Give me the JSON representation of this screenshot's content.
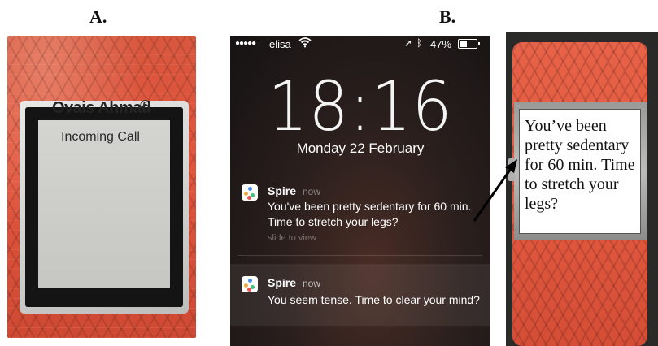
{
  "labels": {
    "panel_a": "A.",
    "panel_b": "B."
  },
  "watch_a": {
    "caller_name": "Ovais Ahmad",
    "phone_icon": "phone-icon",
    "call_status": "Incoming Call"
  },
  "lockscreen": {
    "status_bar": {
      "signal": "●●●●●",
      "carrier": "elisa",
      "wifi_icon": "wifi-icon",
      "location_icon": "location-arrow-icon",
      "bluetooth_icon": "bluetooth-icon",
      "battery_percent": "47%",
      "battery_level": 0.47
    },
    "time": "18:16",
    "date": "Monday 22 February",
    "notifications": [
      {
        "app": "Spire",
        "time": "now",
        "message": "You've been pretty sedentary for 60 min. Time to stretch your legs?",
        "hint": "slide to view"
      },
      {
        "app": "Spire",
        "time": "now",
        "message": "You seem tense. Time to clear your mind?"
      }
    ]
  },
  "watch_c": {
    "message": "You’ve been pretty sedentary for 60 min. Time to stretch your legs?"
  },
  "colors": {
    "band": "#e35a40",
    "lockscreen_bg": "#2a1f1d",
    "app_icon_blue": "#4a8cf0",
    "app_icon_orange": "#f2a93b",
    "app_icon_green": "#3ec47a",
    "app_icon_red": "#e8554f"
  }
}
